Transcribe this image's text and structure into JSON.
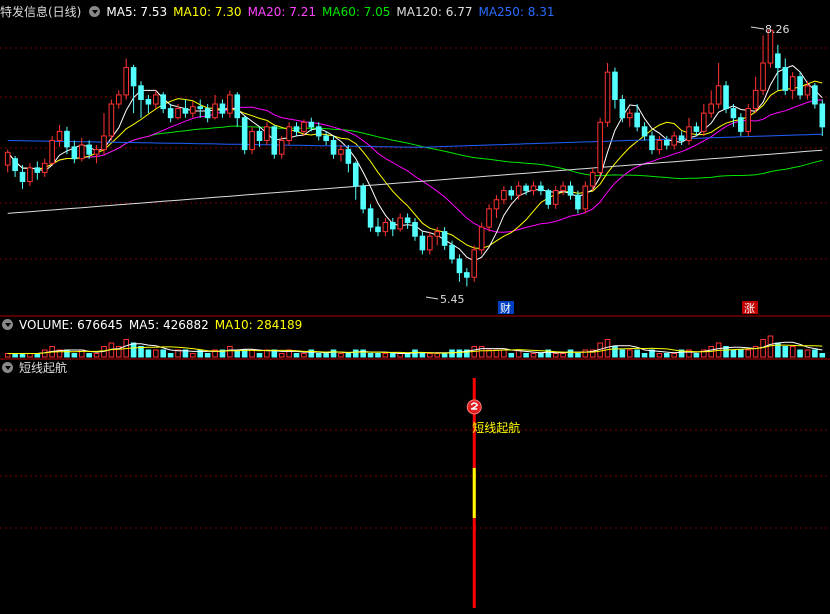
{
  "colors": {
    "up": "#ff3232",
    "down": "#54ffff",
    "ma5": "#ffffff",
    "ma10": "#ffff00",
    "ma20": "#ff00ff",
    "ma60": "#00e600",
    "ma120": "#dddddd",
    "ma250": "#2060ff",
    "vol": "#ffffff",
    "signal": "#ff0000",
    "signal_mid": "#ffff00",
    "grid": "#7a0000"
  },
  "main": {
    "title": "特发信息(日线)",
    "ma": {
      "ma5": "MA5: 7.53",
      "ma10": "MA10: 7.30",
      "ma20": "MA20: 7.21",
      "ma60": "MA60: 7.05",
      "ma120": "MA120: 6.77",
      "ma250": "MA250: 8.31"
    },
    "high_label": "8.26",
    "low_label": "5.45",
    "badge_cai": "财",
    "badge_zhang": "涨"
  },
  "volume": {
    "label": "VOLUME: 676645",
    "ma5": "MA5: 426882",
    "ma10": "MA10: 284189"
  },
  "indicator": {
    "title": "短线起航",
    "signal_text": "短线起航"
  },
  "chart_data": {
    "type": "candlestick",
    "title": "特发信息(日线)",
    "high": 8.26,
    "low": 5.45,
    "price_range": [
      5.3,
      8.35
    ],
    "candles": [
      [
        6.78,
        6.92,
        6.7,
        6.95
      ],
      [
        6.85,
        6.72,
        6.65,
        6.88
      ],
      [
        6.7,
        6.6,
        6.52,
        6.78
      ],
      [
        6.6,
        6.75,
        6.55,
        6.8
      ],
      [
        6.75,
        6.7,
        6.62,
        6.82
      ],
      [
        6.7,
        6.8,
        6.65,
        6.85
      ],
      [
        6.8,
        7.05,
        6.78,
        7.1
      ],
      [
        7.05,
        7.15,
        6.98,
        7.22
      ],
      [
        7.15,
        6.98,
        6.9,
        7.2
      ],
      [
        6.98,
        6.85,
        6.8,
        7.05
      ],
      [
        6.85,
        7.0,
        6.82,
        7.08
      ],
      [
        7.0,
        6.9,
        6.85,
        7.05
      ],
      [
        6.9,
        6.95,
        6.8,
        7.0
      ],
      [
        6.95,
        7.1,
        6.9,
        7.35
      ],
      [
        7.1,
        7.45,
        7.05,
        7.5
      ],
      [
        7.45,
        7.55,
        7.4,
        7.6
      ],
      [
        7.55,
        7.85,
        7.5,
        7.95
      ],
      [
        7.85,
        7.65,
        7.35,
        7.88
      ],
      [
        7.65,
        7.5,
        7.3,
        7.7
      ],
      [
        7.5,
        7.45,
        7.35,
        7.55
      ],
      [
        7.45,
        7.55,
        7.4,
        7.6
      ],
      [
        7.55,
        7.4,
        7.35,
        7.58
      ],
      [
        7.4,
        7.3,
        7.25,
        7.45
      ],
      [
        7.3,
        7.4,
        7.28,
        7.45
      ],
      [
        7.4,
        7.35,
        7.3,
        7.5
      ],
      [
        7.35,
        7.42,
        7.3,
        7.48
      ],
      [
        7.42,
        7.4,
        7.3,
        7.5
      ],
      [
        7.4,
        7.3,
        7.25,
        7.45
      ],
      [
        7.3,
        7.45,
        7.28,
        7.55
      ],
      [
        7.45,
        7.35,
        7.3,
        7.5
      ],
      [
        7.35,
        7.55,
        7.3,
        7.6
      ],
      [
        7.55,
        7.3,
        7.2,
        7.58
      ],
      [
        7.3,
        6.95,
        6.9,
        7.32
      ],
      [
        6.95,
        7.15,
        6.9,
        7.2
      ],
      [
        7.15,
        7.05,
        6.98,
        7.2
      ],
      [
        7.05,
        7.2,
        7.0,
        7.25
      ],
      [
        7.2,
        6.9,
        6.85,
        7.22
      ],
      [
        6.9,
        7.05,
        6.85,
        7.1
      ],
      [
        7.05,
        7.2,
        7.0,
        7.25
      ],
      [
        7.2,
        7.15,
        7.1,
        7.25
      ],
      [
        7.15,
        7.25,
        7.1,
        7.28
      ],
      [
        7.25,
        7.2,
        7.15,
        7.3
      ],
      [
        7.2,
        7.1,
        7.05,
        7.25
      ],
      [
        7.1,
        7.05,
        7.0,
        7.15
      ],
      [
        7.05,
        6.9,
        6.85,
        7.1
      ],
      [
        6.9,
        6.95,
        6.82,
        7.0
      ],
      [
        6.95,
        6.8,
        6.7,
        7.0
      ],
      [
        6.8,
        6.55,
        6.4,
        6.82
      ],
      [
        6.55,
        6.3,
        6.25,
        6.58
      ],
      [
        6.3,
        6.1,
        6.05,
        6.35
      ],
      [
        6.1,
        6.05,
        6.0,
        6.2
      ],
      [
        6.05,
        6.15,
        6.0,
        6.2
      ],
      [
        6.15,
        6.08,
        6.0,
        6.2
      ],
      [
        6.08,
        6.2,
        6.05,
        6.25
      ],
      [
        6.2,
        6.15,
        6.08,
        6.25
      ],
      [
        6.15,
        6.0,
        5.95,
        6.2
      ],
      [
        6.0,
        5.85,
        5.8,
        6.05
      ],
      [
        5.85,
        6.0,
        5.8,
        6.05
      ],
      [
        6.0,
        6.05,
        5.9,
        6.1
      ],
      [
        6.05,
        5.9,
        5.85,
        6.1
      ],
      [
        5.9,
        5.75,
        5.7,
        5.95
      ],
      [
        5.75,
        5.6,
        5.5,
        5.8
      ],
      [
        5.6,
        5.55,
        5.45,
        5.65
      ],
      [
        5.55,
        5.85,
        5.5,
        5.9
      ],
      [
        5.85,
        6.1,
        5.8,
        6.15
      ],
      [
        6.1,
        6.3,
        6.05,
        6.35
      ],
      [
        6.3,
        6.4,
        6.2,
        6.45
      ],
      [
        6.4,
        6.5,
        6.35,
        6.55
      ],
      [
        6.5,
        6.45,
        6.4,
        6.55
      ],
      [
        6.45,
        6.55,
        6.4,
        6.6
      ],
      [
        6.55,
        6.5,
        6.45,
        6.58
      ],
      [
        6.5,
        6.55,
        6.45,
        6.6
      ],
      [
        6.55,
        6.5,
        6.45,
        6.6
      ],
      [
        6.5,
        6.35,
        6.3,
        6.52
      ],
      [
        6.35,
        6.5,
        6.3,
        6.55
      ],
      [
        6.5,
        6.55,
        6.45,
        6.6
      ],
      [
        6.55,
        6.45,
        6.4,
        6.6
      ],
      [
        6.45,
        6.3,
        6.25,
        6.5
      ],
      [
        6.3,
        6.55,
        6.25,
        6.6
      ],
      [
        6.55,
        6.7,
        6.5,
        6.75
      ],
      [
        6.7,
        7.25,
        6.65,
        7.3
      ],
      [
        7.25,
        7.8,
        7.2,
        7.9
      ],
      [
        7.8,
        7.5,
        7.4,
        7.85
      ],
      [
        7.5,
        7.3,
        7.25,
        7.55
      ],
      [
        7.3,
        7.35,
        7.2,
        7.4
      ],
      [
        7.35,
        7.2,
        7.15,
        7.45
      ],
      [
        7.2,
        7.1,
        7.05,
        7.25
      ],
      [
        7.1,
        6.95,
        6.9,
        7.15
      ],
      [
        6.95,
        7.05,
        6.9,
        7.1
      ],
      [
        7.05,
        7.0,
        6.95,
        7.1
      ],
      [
        7.0,
        7.1,
        6.95,
        7.15
      ],
      [
        7.1,
        7.05,
        7.0,
        7.15
      ],
      [
        7.05,
        7.2,
        7.0,
        7.3
      ],
      [
        7.2,
        7.15,
        7.1,
        7.25
      ],
      [
        7.15,
        7.35,
        7.1,
        7.45
      ],
      [
        7.35,
        7.45,
        7.3,
        7.6
      ],
      [
        7.45,
        7.65,
        7.4,
        7.9
      ],
      [
        7.65,
        7.4,
        7.35,
        7.7
      ],
      [
        7.4,
        7.3,
        7.2,
        7.45
      ],
      [
        7.3,
        7.15,
        7.1,
        7.35
      ],
      [
        7.15,
        7.4,
        7.1,
        7.45
      ],
      [
        7.4,
        7.6,
        7.35,
        7.75
      ],
      [
        7.6,
        7.9,
        7.55,
        8.2
      ],
      [
        7.9,
        8.26,
        7.85,
        8.26
      ],
      [
        8.0,
        7.85,
        7.6,
        8.1
      ],
      [
        7.85,
        7.6,
        7.55,
        7.95
      ],
      [
        7.6,
        7.75,
        7.5,
        7.8
      ],
      [
        7.75,
        7.55,
        7.5,
        7.8
      ],
      [
        7.55,
        7.65,
        7.5,
        7.7
      ],
      [
        7.65,
        7.45,
        7.4,
        7.68
      ],
      [
        7.45,
        7.2,
        7.1,
        7.5
      ]
    ],
    "volume": [
      1,
      1,
      1,
      1,
      1,
      2,
      3,
      2,
      2,
      1,
      2,
      1,
      1,
      3,
      4,
      3,
      5,
      4,
      3,
      2,
      2,
      2,
      1,
      2,
      2,
      1,
      2,
      1,
      2,
      2,
      3,
      2,
      2,
      2,
      1,
      2,
      2,
      1,
      2,
      1,
      1,
      2,
      1,
      1,
      2,
      1,
      1,
      2,
      2,
      1,
      1,
      1,
      1,
      1,
      1,
      2,
      1,
      1,
      1,
      1,
      2,
      2,
      2,
      3,
      3,
      2,
      2,
      2,
      1,
      2,
      1,
      1,
      1,
      2,
      1,
      1,
      2,
      1,
      2,
      2,
      4,
      5,
      3,
      2,
      2,
      2,
      1,
      2,
      1,
      1,
      1,
      2,
      2,
      1,
      2,
      3,
      4,
      3,
      2,
      2,
      2,
      3,
      5,
      6,
      4,
      3,
      3,
      2,
      2,
      2,
      1
    ],
    "indicator_signal_index": 63
  }
}
